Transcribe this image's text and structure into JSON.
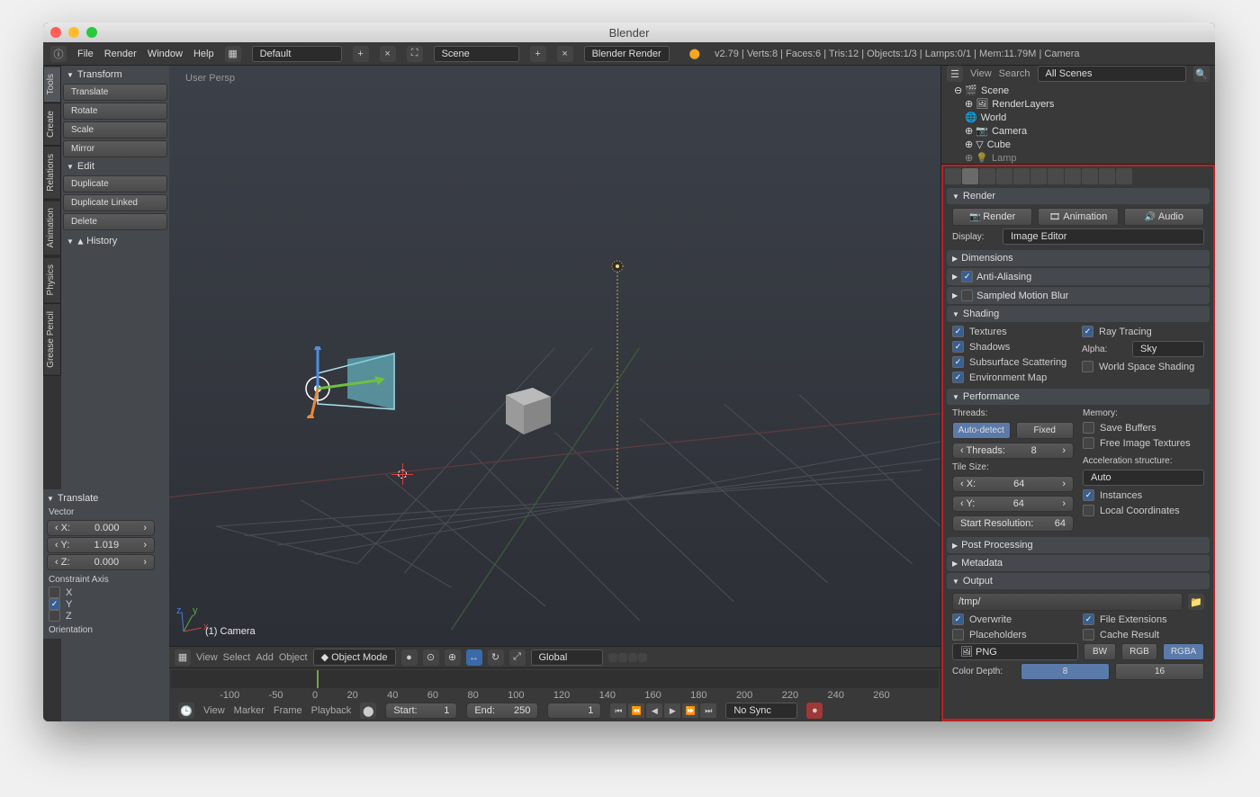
{
  "app": {
    "title": "Blender"
  },
  "top_menu": [
    "File",
    "Render",
    "Window",
    "Help"
  ],
  "layout_dropdown": "Default",
  "scene_dropdown": "Scene",
  "engine_dropdown": "Blender Render",
  "stats": "v2.79 | Verts:8 | Faces:6 | Tris:12 | Objects:1/3 | Lamps:0/1 | Mem:11.79M | Camera",
  "left_tabs": [
    "Tools",
    "Create",
    "Relations",
    "Animation",
    "Physics",
    "Grease Pencil"
  ],
  "tool_panels": {
    "transform": {
      "title": "Transform",
      "items": [
        "Translate",
        "Rotate",
        "Scale",
        "Mirror"
      ]
    },
    "edit": {
      "title": "Edit",
      "items": [
        "Duplicate",
        "Duplicate Linked",
        "Delete"
      ]
    },
    "history": {
      "title": "History"
    }
  },
  "viewport": {
    "hud": "User Persp",
    "selected": "(1) Camera"
  },
  "operator": {
    "title": "Translate",
    "vector_label": "Vector",
    "x": "0.000",
    "y": "1.019",
    "z": "0.000",
    "constraint_label": "Constraint Axis",
    "cx": false,
    "cy": true,
    "cz": false,
    "orientation_label": "Orientation"
  },
  "view3d_header": {
    "menus": [
      "View",
      "Select",
      "Add",
      "Object"
    ],
    "mode": "Object Mode",
    "orientation": "Global"
  },
  "timeline": {
    "ticks": [
      "-100",
      "-50",
      "0",
      "20",
      "40",
      "60",
      "80",
      "100",
      "120",
      "140",
      "160",
      "180",
      "200",
      "220",
      "240",
      "260"
    ],
    "menus": [
      "View",
      "Marker",
      "Frame",
      "Playback"
    ],
    "start_label": "Start:",
    "start": "1",
    "end_label": "End:",
    "end": "250",
    "current": "1",
    "sync": "No Sync"
  },
  "outliner": {
    "menus": [
      "View",
      "Search"
    ],
    "filter": "All Scenes",
    "root": "Scene",
    "items": [
      "RenderLayers",
      "World",
      "Camera",
      "Cube",
      "Lamp"
    ]
  },
  "props": {
    "render": {
      "title": "Render",
      "buttons": {
        "render": "Render",
        "animation": "Animation",
        "audio": "Audio"
      },
      "display_label": "Display:",
      "display": "Image Editor"
    },
    "dimensions": "Dimensions",
    "antialiasing": "Anti-Aliasing",
    "antialiasing_on": true,
    "motion_blur": "Sampled Motion Blur",
    "motion_blur_on": false,
    "shading": {
      "title": "Shading",
      "textures": "Textures",
      "shadows": "Shadows",
      "sss": "Subsurface Scattering",
      "envmap": "Environment Map",
      "raytracing": "Ray Tracing",
      "alpha_label": "Alpha:",
      "alpha": "Sky",
      "wss": "World Space Shading"
    },
    "performance": {
      "title": "Performance",
      "threads_label": "Threads:",
      "auto": "Auto-detect",
      "fixed": "Fixed",
      "threads_num": "8",
      "tile_label": "Tile Size:",
      "tx": "64",
      "ty": "64",
      "start_res": "Start Resolution:",
      "start_res_v": "64",
      "memory_label": "Memory:",
      "save_buf": "Save Buffers",
      "free_img": "Free Image Textures",
      "accel_label": "Acceleration structure:",
      "accel": "Auto",
      "instances": "Instances",
      "localcoords": "Local Coordinates"
    },
    "post": "Post Processing",
    "metadata": "Metadata",
    "output": {
      "title": "Output",
      "path": "/tmp/",
      "overwrite": "Overwrite",
      "placeholders": "Placeholders",
      "fileext": "File Extensions",
      "cache": "Cache Result",
      "format": "PNG",
      "bw": "BW",
      "rgb": "RGB",
      "rgba": "RGBA",
      "depth_label": "Color Depth:",
      "d8": "8",
      "d16": "16"
    }
  }
}
